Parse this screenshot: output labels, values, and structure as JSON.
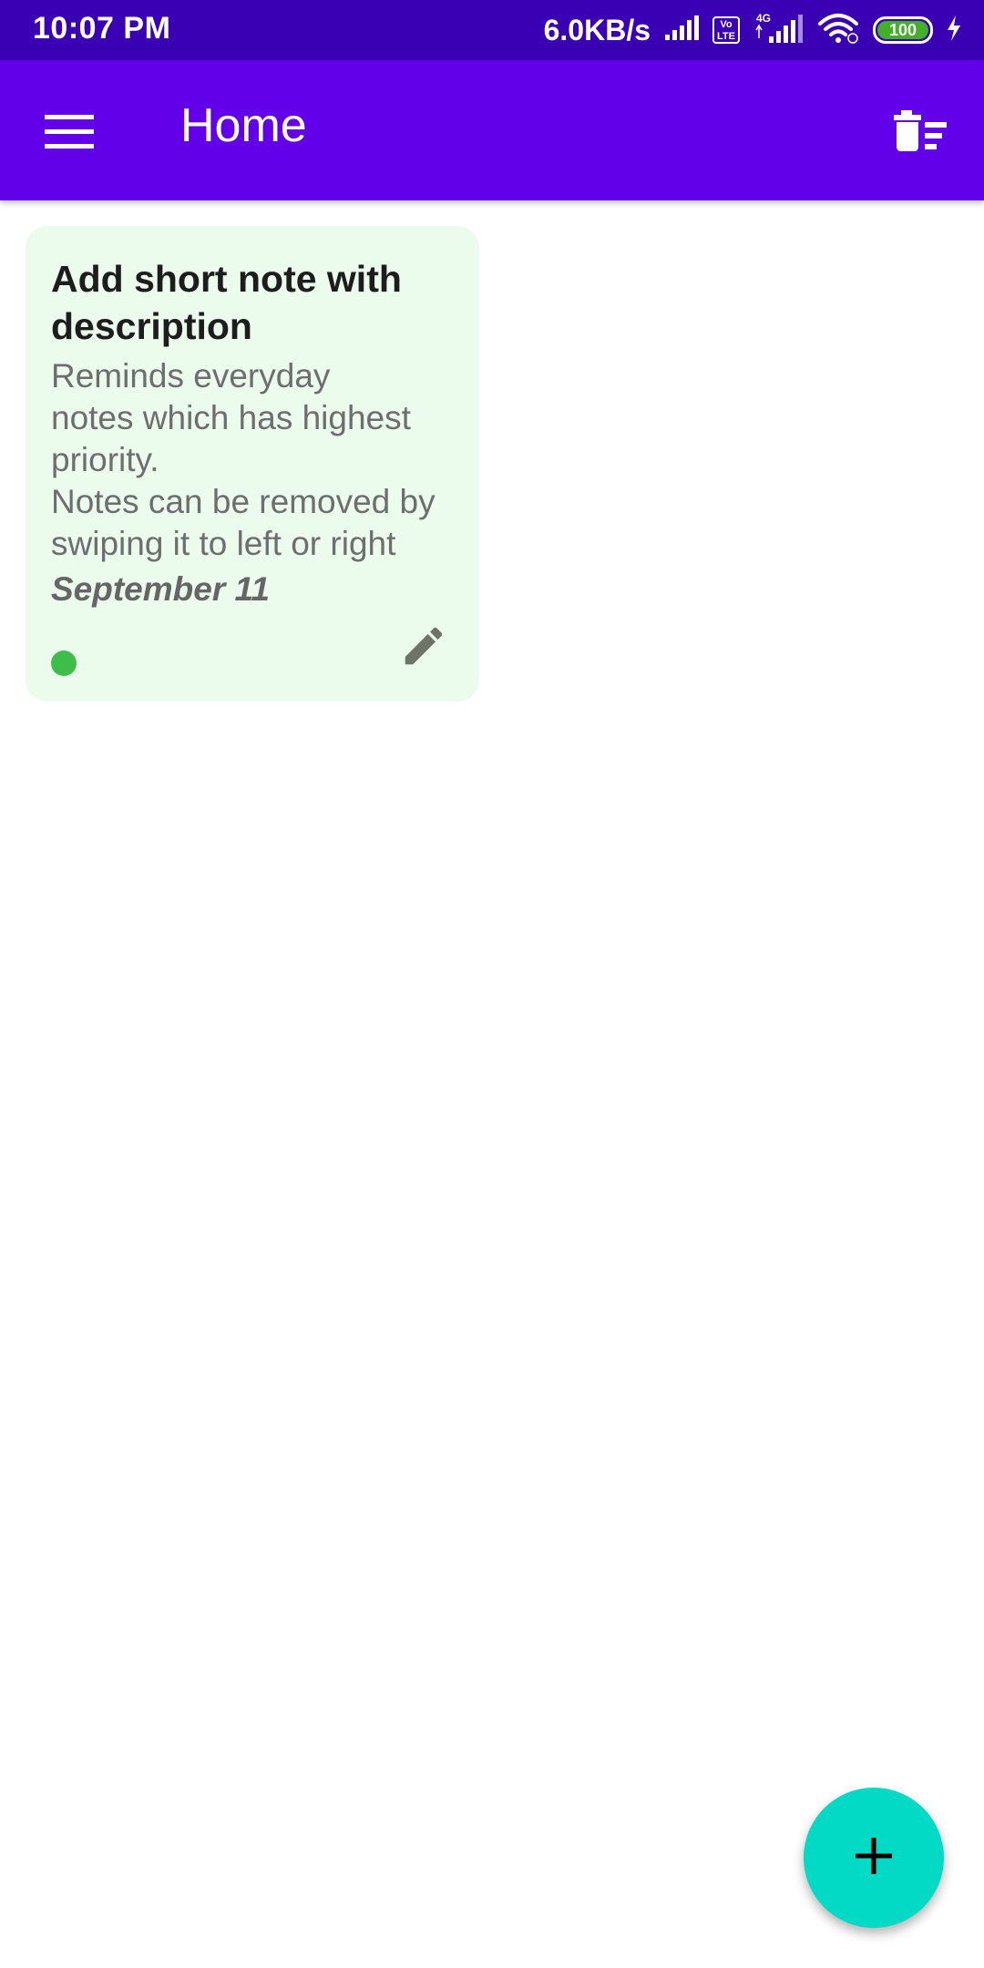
{
  "status_bar": {
    "time": "10:07 PM",
    "net_speed": "6.0KB/s",
    "volte_label": "Vo\nLTE",
    "network_type": "4G",
    "battery_level": "100",
    "icons": [
      "signal-icon",
      "volte-icon",
      "signal-4g-icon",
      "wifi-icon",
      "battery-icon",
      "charging-icon"
    ]
  },
  "app_bar": {
    "title": "Home",
    "menu_icon": "hamburger-menu-icon",
    "action_icon": "delete-sweep-icon",
    "background_color": "#6200ea"
  },
  "notes": [
    {
      "title": "Add short note with description",
      "description": "Reminds everyday\nnotes which has highest\npriority.\nNotes can be removed by\nswiping it to left or right",
      "date": "September 11",
      "priority_color": "#3ebd4a",
      "card_color": "#ebfbec",
      "edit_icon": "pencil-icon"
    }
  ],
  "fab": {
    "icon": "plus-icon",
    "color": "#03dac5"
  }
}
